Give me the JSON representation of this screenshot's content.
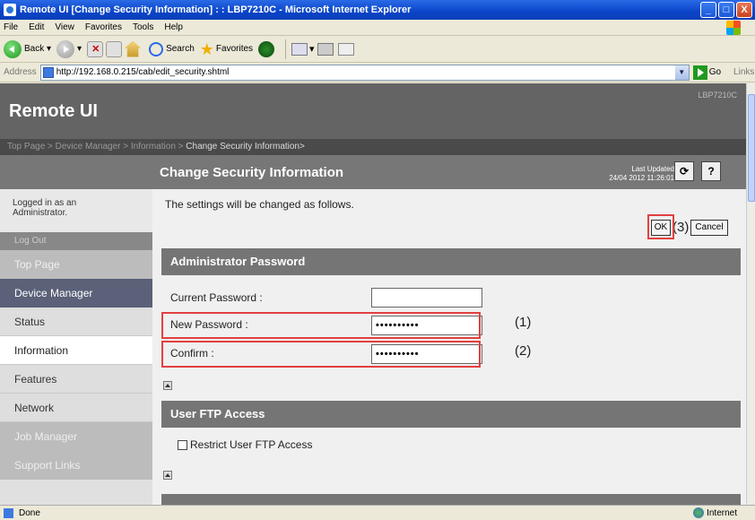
{
  "window": {
    "title": "Remote UI [Change Security Information] : : LBP7210C - Microsoft Internet Explorer",
    "min": "_",
    "max": "□",
    "close": "X"
  },
  "menu": [
    "File",
    "Edit",
    "View",
    "Favorites",
    "Tools",
    "Help"
  ],
  "toolbar": {
    "back": "Back",
    "search": "Search",
    "favorites": "Favorites"
  },
  "address": {
    "label": "Address",
    "url": "http://192.168.0.215/cab/edit_security.shtml",
    "go": "Go",
    "links": "Links"
  },
  "header": {
    "title": "Remote UI",
    "model": "LBP7210C"
  },
  "breadcrumb": {
    "trail": "Top Page >   Device Manager >   Information > ",
    "current": "Change Security Information>"
  },
  "page": {
    "title": "Change Security Information",
    "last_updated_label": "Last Updated",
    "last_updated_value": "24/04 2012 11:26:01",
    "refresh": "⟳",
    "help": "?"
  },
  "sidebar": {
    "login": "Logged in as an\nAdministrator.",
    "logout": "Log Out",
    "items": [
      {
        "label": "Top Page",
        "kind": "top"
      },
      {
        "label": "Device Manager",
        "kind": "group"
      },
      {
        "label": "Status",
        "kind": "sub"
      },
      {
        "label": "Information",
        "kind": "sub-active"
      },
      {
        "label": "Features",
        "kind": "sub"
      },
      {
        "label": "Network",
        "kind": "sub"
      },
      {
        "label": "Job Manager",
        "kind": "dim"
      },
      {
        "label": "Support Links",
        "kind": "dim"
      }
    ]
  },
  "main": {
    "message": "The settings will be changed as follows.",
    "ok": "OK",
    "cancel": "Cancel",
    "callout_ok": "(3)",
    "admin_section": "Administrator Password",
    "current_password_label": "Current Password :",
    "current_password_value": "",
    "new_password_label": "New Password :",
    "new_password_value": "••••••••••",
    "confirm_label": "Confirm :",
    "confirm_value": "••••••••••",
    "callout_new": "(1)",
    "callout_confirm": "(2)",
    "ftp_section": "User FTP Access",
    "ftp_checkbox_label": "Restrict User FTP Access"
  },
  "status": {
    "text": "Done",
    "zone": "Internet"
  }
}
